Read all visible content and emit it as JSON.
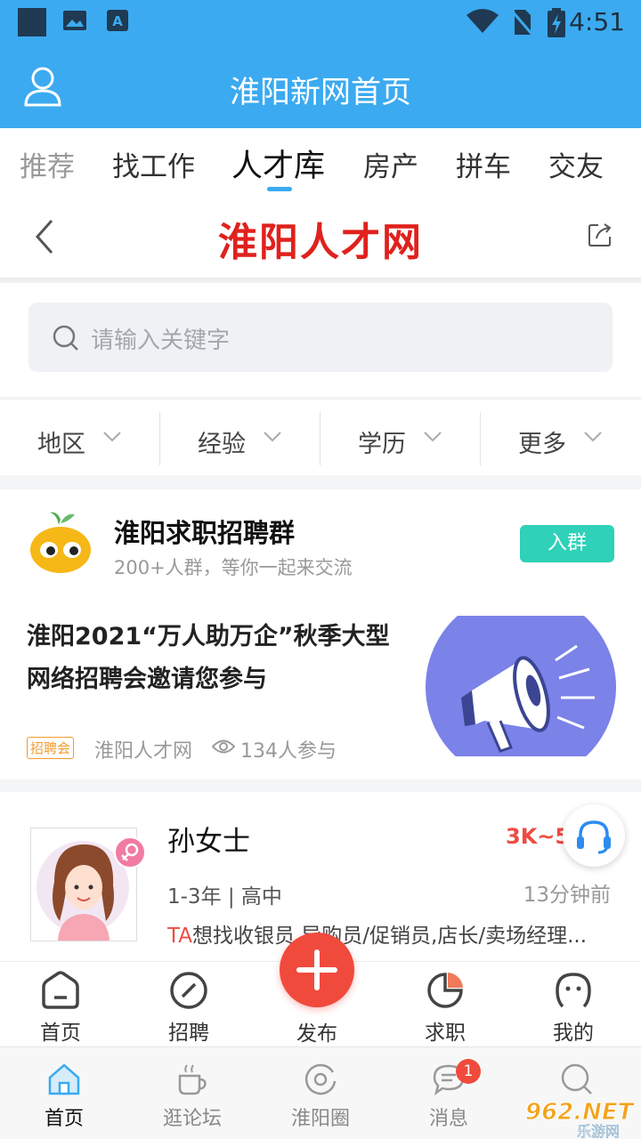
{
  "status_bar": {
    "time": "4:51"
  },
  "header": {
    "title": "淮阳新网首页"
  },
  "tabs": [
    {
      "label": "推荐"
    },
    {
      "label": "找工作"
    },
    {
      "label": "人才库"
    },
    {
      "label": "房产"
    },
    {
      "label": "拼车"
    },
    {
      "label": "交友"
    }
  ],
  "site": {
    "logo_text": "淮阳人才网"
  },
  "search": {
    "placeholder": "请输入关键字"
  },
  "filters": [
    {
      "label": "地区"
    },
    {
      "label": "经验"
    },
    {
      "label": "学历"
    },
    {
      "label": "更多"
    }
  ],
  "group": {
    "title": "淮阳求职招聘群",
    "subtitle": "200+人群，等你一起来交流",
    "join_label": "入群"
  },
  "news": {
    "title": "淮阳2021“万人助万企”秋季大型网络招聘会邀请您参与",
    "tag": "招聘会",
    "source": "淮阳人才网",
    "participants": "134人参与"
  },
  "seeker": {
    "name": "孙女士",
    "salary": "3K~5",
    "experience": "1-3年 | 高中",
    "time_ago": "13分钟前",
    "want_prefix": "TA",
    "want_text": "想找收银员,导购员/促销员,店长/卖场经理..."
  },
  "inner_nav": [
    {
      "label": "首页",
      "icon": "home-outline-icon"
    },
    {
      "label": "招聘",
      "icon": "compass-icon"
    },
    {
      "label": "发布",
      "icon": "plus-icon"
    },
    {
      "label": "求职",
      "icon": "pie-chart-icon"
    },
    {
      "label": "我的",
      "icon": "face-icon"
    }
  ],
  "app_nav": [
    {
      "label": "首页",
      "icon": "home-icon"
    },
    {
      "label": "逛论坛",
      "icon": "coffee-cup-icon"
    },
    {
      "label": "淮阳圈",
      "icon": "circle-icon"
    },
    {
      "label": "消息",
      "icon": "chat-icon",
      "badge": "1"
    },
    {
      "label": "",
      "icon": "search-icon"
    }
  ],
  "watermark": {
    "text_top": "962.NET",
    "text_bottom": "乐游网"
  },
  "colors": {
    "accent": "#3baaf0",
    "brand_red": "#e0211d",
    "join_green": "#2fd1b8",
    "salary_red": "#ef4b41",
    "tag_orange": "#f29a2e"
  }
}
